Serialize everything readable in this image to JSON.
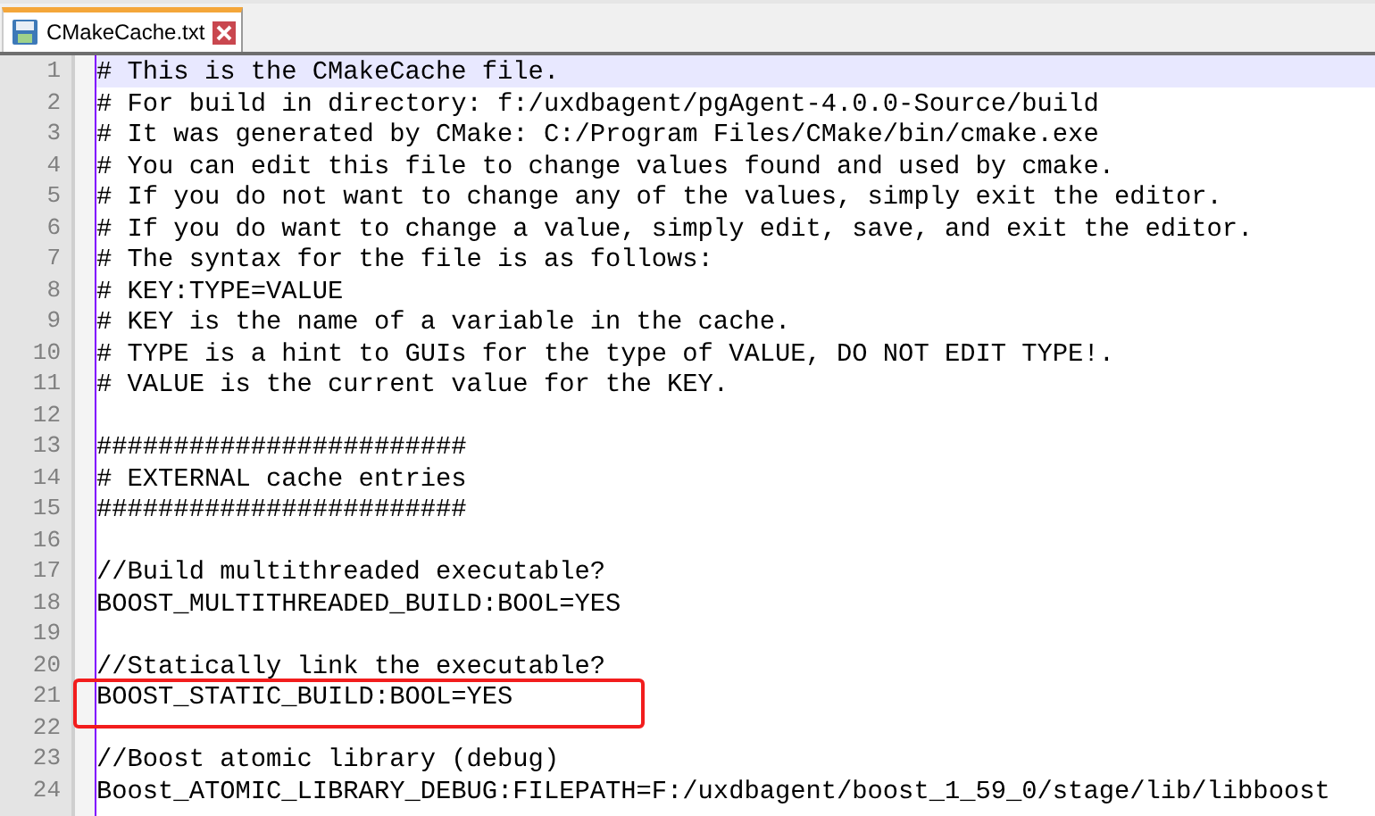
{
  "tabs": [
    {
      "label": "CMakeCache.txt",
      "selected": true
    }
  ],
  "editor": {
    "lines": [
      {
        "number": "1",
        "text": "# This is the CMakeCache file.",
        "current": true,
        "boxed": false
      },
      {
        "number": "2",
        "text": "# For build in directory: f:/uxdbagent/pgAgent-4.0.0-Source/build",
        "current": false,
        "boxed": false
      },
      {
        "number": "3",
        "text": "# It was generated by CMake: C:/Program Files/CMake/bin/cmake.exe",
        "current": false,
        "boxed": false
      },
      {
        "number": "4",
        "text": "# You can edit this file to change values found and used by cmake.",
        "current": false,
        "boxed": false
      },
      {
        "number": "5",
        "text": "# If you do not want to change any of the values, simply exit the editor.",
        "current": false,
        "boxed": false
      },
      {
        "number": "6",
        "text": "# If you do want to change a value, simply edit, save, and exit the editor.",
        "current": false,
        "boxed": false
      },
      {
        "number": "7",
        "text": "# The syntax for the file is as follows:",
        "current": false,
        "boxed": false
      },
      {
        "number": "8",
        "text": "# KEY:TYPE=VALUE",
        "current": false,
        "boxed": false
      },
      {
        "number": "9",
        "text": "# KEY is the name of a variable in the cache.",
        "current": false,
        "boxed": false
      },
      {
        "number": "10",
        "text": "# TYPE is a hint to GUIs for the type of VALUE, DO NOT EDIT TYPE!.",
        "current": false,
        "boxed": false
      },
      {
        "number": "11",
        "text": "# VALUE is the current value for the KEY.",
        "current": false,
        "boxed": false
      },
      {
        "number": "12",
        "current": false,
        "boxed": false
      },
      {
        "number": "13",
        "text": "########################",
        "current": false,
        "boxed": false
      },
      {
        "number": "14",
        "text": "# EXTERNAL cache entries",
        "current": false,
        "boxed": false
      },
      {
        "number": "15",
        "text": "########################",
        "current": false,
        "boxed": false
      },
      {
        "number": "16",
        "current": false,
        "boxed": false
      },
      {
        "number": "17",
        "text": "//Build multithreaded executable?",
        "current": false,
        "boxed": false
      },
      {
        "number": "18",
        "text": "BOOST_MULTITHREADED_BUILD:BOOL=YES",
        "current": false,
        "boxed": false
      },
      {
        "number": "19",
        "current": false,
        "boxed": false
      },
      {
        "number": "20",
        "text": "//Statically link the executable?",
        "current": false,
        "boxed": false
      },
      {
        "number": "21",
        "text": "BOOST_STATIC_BUILD:BOOL=YES",
        "current": false,
        "boxed": true
      },
      {
        "number": "22",
        "current": false,
        "boxed": false
      },
      {
        "number": "23",
        "text": "//Boost atomic library (debug)",
        "current": false,
        "boxed": false
      },
      {
        "number": "24",
        "text": "Boost_ATOMIC_LIBRARY_DEBUG:FILEPATH=F:/uxdbagent/boost_1_59_0/stage/lib/libboost",
        "current": false,
        "boxed": false
      }
    ]
  }
}
